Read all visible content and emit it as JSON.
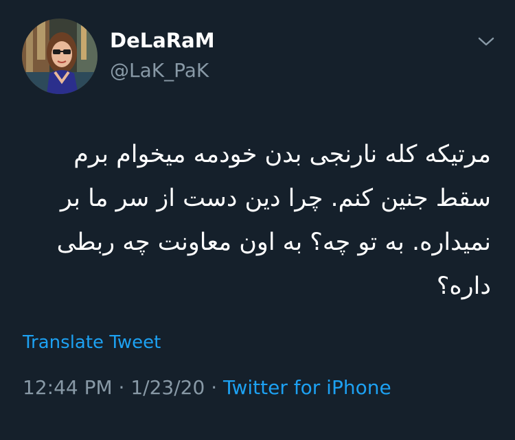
{
  "user": {
    "display_name": "DeLaRaM",
    "handle": "@LaK_PaK"
  },
  "tweet": {
    "text": "مرتیکه کله نارنجی بدن خودمه میخوام برم سقط جنین کنم. چرا دین دست از سر ما بر نمیداره. به تو چه؟ به اون معاونت چه ربطی داره؟",
    "translate_label": "Translate Tweet",
    "time": "12:44 PM",
    "separator_1": "·",
    "date": "1/23/20",
    "separator_2": "·",
    "source": "Twitter for iPhone"
  },
  "icons": {
    "more": "chevron-down-icon",
    "avatar": "profile-photo"
  },
  "colors": {
    "background": "#15202b",
    "primary_text": "#ffffff",
    "secondary_text": "#8899a6",
    "link": "#1da1f2"
  }
}
